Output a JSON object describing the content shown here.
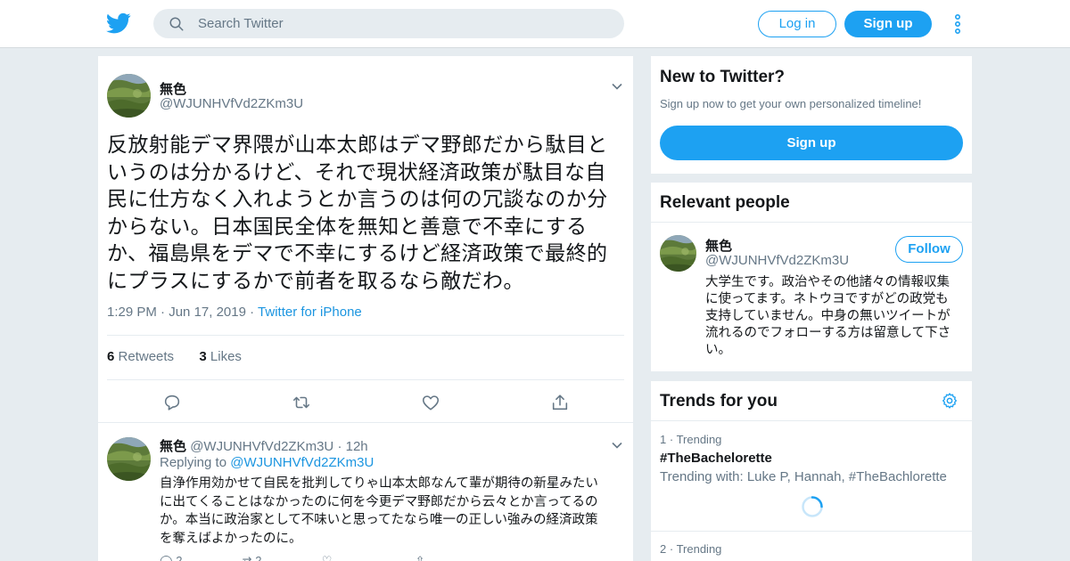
{
  "header": {
    "search_placeholder": "Search Twitter",
    "login_label": "Log in",
    "signup_label": "Sign up"
  },
  "tweet": {
    "author_name": "無色",
    "author_handle": "@WJUNHVfVd2ZKm3U",
    "lines": [
      "反放射能デマ界隈が山本太郎はデマ野郎だから駄目と",
      "いうのは分かるけど、それで現状経済政策が駄目な自",
      "民に仕方なく入れようとか言うのは何の冗談なのか分",
      "からない。日本国民全体を無知と善意で不幸にする",
      "か、福島県をデマで不幸にするけど経済政策で最終的",
      "にプラスにするかで前者を取るなら敵だわ。"
    ],
    "time": "1:29 PM",
    "date": "Jun 17, 2019",
    "source": "Twitter for iPhone",
    "retweet_count": "6",
    "retweet_label": "Retweets",
    "like_count": "3",
    "like_label": "Likes"
  },
  "reply": {
    "author_name": "無色",
    "author_handle": "@WJUNHVfVd2ZKm3U",
    "age": "12h",
    "replying_label": "Replying to",
    "replying_handle": "@WJUNHVfVd2ZKm3U",
    "lines": [
      "自浄作用効かせて自民を批判してりゃ山本太郎なんて輩が期待の新星みたい",
      "に出てくることはなかったのに何を今更デマ野郎だから云々とか言ってるの",
      "か。本当に政治家として不味いと思ってたなら唯一の正しい強みの経済政策",
      "を奪えばよかったのに。"
    ],
    "reply_count": "2",
    "retweet_count": "2"
  },
  "new_to_twitter": {
    "title": "New to Twitter?",
    "subtitle": "Sign up now to get your own personalized timeline!",
    "button": "Sign up"
  },
  "relevant_people": {
    "title": "Relevant people",
    "name": "無色",
    "handle": "@WJUNHVfVd2ZKm3U",
    "follow_label": "Follow",
    "bio_lines": [
      "大学生です。政治やその他諸々の情報収集",
      "に使ってます。ネトウヨですがどの政党も",
      "支持していません。中身の無いツイートが",
      "流れるのでフォローする方は留意して下さ",
      "い。"
    ]
  },
  "trends": {
    "title": "Trends for you",
    "items": [
      {
        "rank": "1",
        "label": "Trending",
        "name": "#TheBachelorette",
        "with": "Trending with: Luke P, Hannah, #TheBachlorette"
      },
      {
        "rank": "2",
        "label": "Trending"
      }
    ]
  },
  "colors": {
    "accent": "#1da1f2",
    "link": "#1b95e0",
    "secondary_text": "#657786",
    "background": "#e6ecf0"
  },
  "icons": [
    "twitter-bird-icon",
    "search-icon",
    "more-vertical-icon",
    "chevron-down-icon",
    "reply-icon",
    "retweet-icon",
    "like-icon",
    "share-icon",
    "settings-gear-icon",
    "loading-spinner-icon"
  ]
}
